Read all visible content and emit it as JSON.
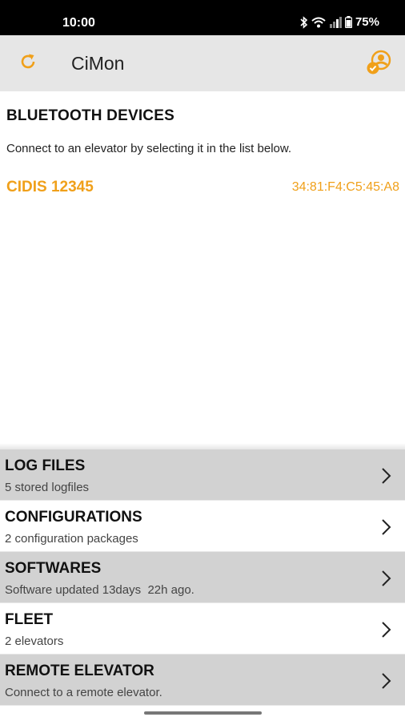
{
  "status_bar": {
    "time": "10:00",
    "battery": "75%",
    "icons": [
      "bluetooth-icon",
      "wifi-icon",
      "signal-icon",
      "battery-icon"
    ]
  },
  "app_bar": {
    "title": "CiMon",
    "refresh_icon": "refresh-icon",
    "account_icon": "account-check-icon",
    "accent_color": "#f0a01a"
  },
  "bluetooth": {
    "title": "BLUETOOTH DEVICES",
    "description": "Connect to an elevator by selecting it in the list below.",
    "devices": [
      {
        "name": "CIDIS 12345",
        "mac": "34:81:F4:C5:45:A8"
      }
    ]
  },
  "menu": {
    "items": [
      {
        "title": "LOG FILES",
        "subtitle": "5 stored logfiles"
      },
      {
        "title": "CONFIGURATIONS",
        "subtitle": "2 configuration packages"
      },
      {
        "title": "SOFTWARES",
        "subtitle": "Software updated 13days  22h ago."
      },
      {
        "title": "FLEET",
        "subtitle": "2 elevators"
      },
      {
        "title": "REMOTE ELEVATOR",
        "subtitle": "Connect to a remote elevator."
      }
    ]
  }
}
